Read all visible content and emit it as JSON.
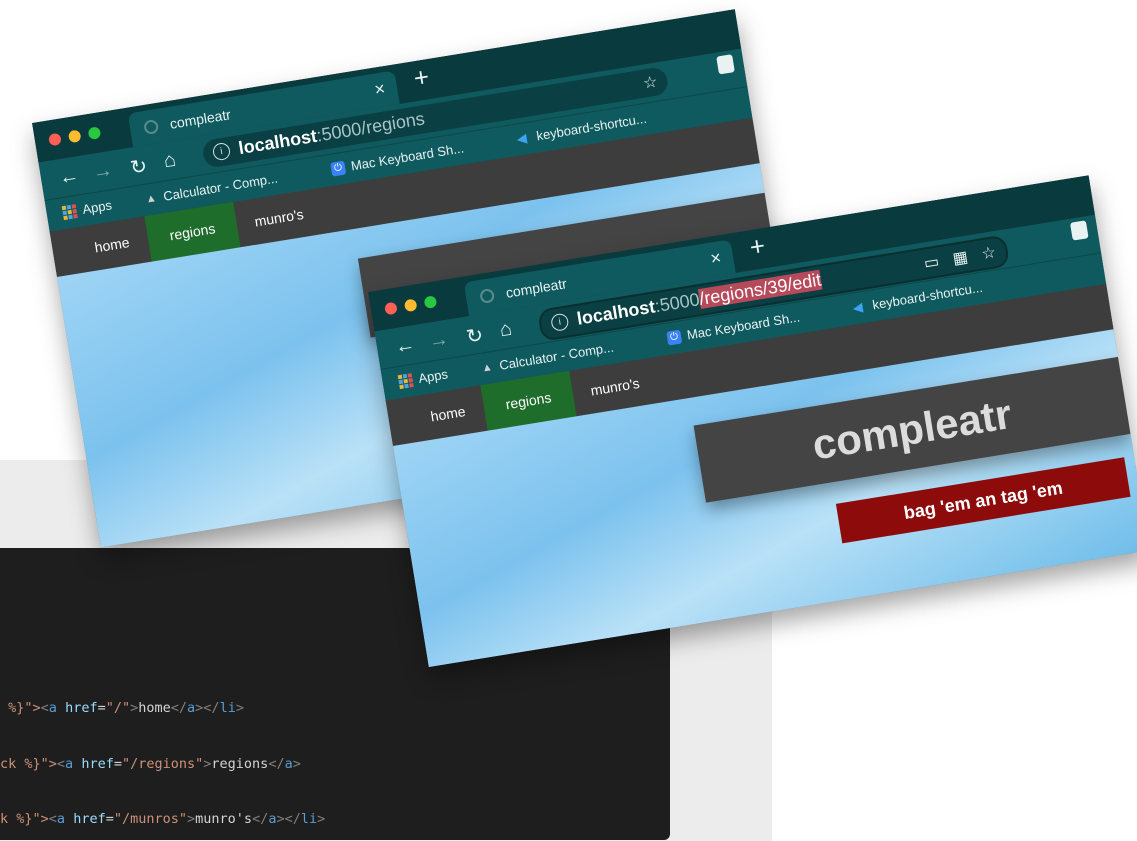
{
  "browser": {
    "tab_title": "compleatr",
    "tab_close": "×",
    "new_tab": "+",
    "url_host": "localhost",
    "url_port": ":5000",
    "url_path_regions": "/regions",
    "url_path_edit": "/regions/39/edit",
    "bookmarks": {
      "apps": "Apps",
      "calculator": "Calculator - Comp...",
      "mac_keyboard": "Mac Keyboard Sh...",
      "keyboard_shortcuts": "keyboard-shortcu..."
    }
  },
  "site": {
    "nav": [
      "home",
      "regions",
      "munro's"
    ],
    "active_nav": "regions",
    "brand_title": "compleatr",
    "tagline": "bag 'em an tag 'em"
  },
  "code_lines": [
    {
      "prefix": " %}\">",
      "href": "\"/\"",
      "text": "home"
    },
    {
      "prefix": "ck %}\">",
      "href": "\"/regions\"",
      "text": "regions"
    },
    {
      "prefix": "k %}\">",
      "href": "\"/munros\"",
      "text": "munro's"
    }
  ],
  "colors": {
    "chrome_dark": "#093a3e",
    "chrome": "#0f5a5f",
    "nav_active": "#1f6d2a",
    "cta": "#8e0b0b",
    "url_highlight": "#b64a5a"
  }
}
